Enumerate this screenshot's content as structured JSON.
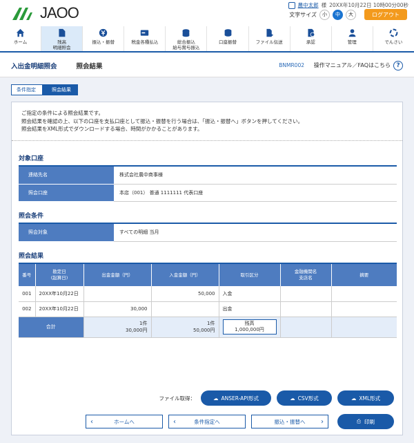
{
  "header": {
    "logo_text": "JAOO",
    "user_name": "農中太郎",
    "user_suffix": "様",
    "last_login": "20XX年10月22日 10時00分00秒",
    "font_size_label": "文字サイズ",
    "font_sizes": [
      "小",
      "中",
      "大"
    ],
    "logout_label": "ログアウト"
  },
  "nav": [
    {
      "label": "ホーム",
      "icon": "home-icon"
    },
    {
      "label": "残高\n明細照会",
      "icon": "document-icon",
      "active": true
    },
    {
      "label": "振込・振替",
      "icon": "transfer-icon"
    },
    {
      "label": "税金各種払込",
      "icon": "payment-icon"
    },
    {
      "label": "総合振込\n給与賞与振込",
      "icon": "coins-icon"
    },
    {
      "label": "口座振替",
      "icon": "coin-stack-icon"
    },
    {
      "label": "ファイル伝送",
      "icon": "file-transfer-icon"
    },
    {
      "label": "承認",
      "icon": "approve-icon"
    },
    {
      "label": "管理",
      "icon": "admin-icon"
    },
    {
      "label": "でんさい",
      "icon": "densai-icon"
    }
  ],
  "page": {
    "category": "入出金明細照会",
    "title": "照会結果",
    "screen_code": "BNMR002",
    "help_label": "操作マニュアル／FAQはこちら"
  },
  "steps": [
    "条件指定",
    "照会結果"
  ],
  "intro": [
    "ご指定の条件による照会結果です。",
    "照会結果を確認の上、以下の口座を支払口座として振込・振替を行う場合は、「振込・振替へ」ボタンを押してください。",
    "照会結果をXML形式でダウンロードする場合、時間がかかることがあります。"
  ],
  "target_account": {
    "heading": "対象口座",
    "rows": [
      {
        "label": "連絡先名",
        "value": "株式会社農中商事様"
      },
      {
        "label": "照会口座",
        "value": "本店（001） 普通 1111111 代表口座"
      }
    ]
  },
  "conditions": {
    "heading": "照会条件",
    "rows": [
      {
        "label": "照会対象",
        "value": "すべての明細 当月"
      }
    ]
  },
  "results": {
    "heading": "照会結果",
    "columns": [
      "番号",
      "勘定日\n(起算日)",
      "出金金額（円）",
      "入金金額（円）",
      "取引区分",
      "金融機関名\n支店名",
      "摘要"
    ],
    "rows": [
      {
        "no": "001",
        "date": "20XX年10月22日",
        "out": "",
        "in": "50,000",
        "type": "入金",
        "bank": "",
        "memo": ""
      },
      {
        "no": "002",
        "date": "20XX年10月22日",
        "out": "30,000",
        "in": "",
        "type": "出金",
        "bank": "",
        "memo": ""
      }
    ],
    "total_label": "合計",
    "total_out_count": "1件",
    "total_out_amount": "30,000円",
    "total_in_count": "1件",
    "total_in_amount": "50,000円",
    "balance_label": "残高",
    "balance_amount": "1,000,000円"
  },
  "file_get": {
    "label": "ファイル取得：",
    "buttons": [
      "ANSER-API形式",
      "CSV形式",
      "XML形式"
    ]
  },
  "buttons": {
    "home": "ホームへ",
    "conditions": "条件指定へ",
    "transfer": "振込・振替へ",
    "print": "印刷"
  }
}
